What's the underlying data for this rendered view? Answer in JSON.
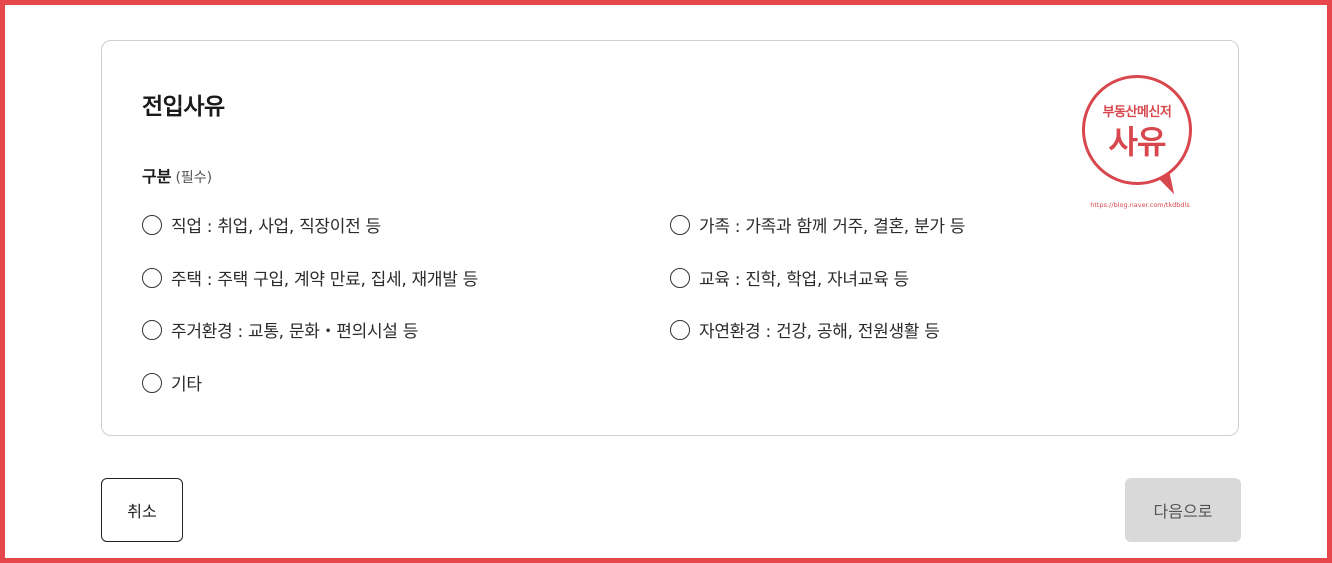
{
  "section": {
    "title": "전입사유",
    "group_label": "구분",
    "group_required": "(필수)"
  },
  "options": [
    {
      "label": "직업 : 취업, 사업, 직장이전 등",
      "selected": false
    },
    {
      "label": "가족 : 가족과 함께 거주, 결혼, 분가 등",
      "selected": false
    },
    {
      "label": "주택 : 주택 구입, 계약 만료, 집세, 재개발 등",
      "selected": false
    },
    {
      "label": "교육 : 진학, 학업, 자녀교육 등",
      "selected": false
    },
    {
      "label": "주거환경 : 교통, 문화・편의시설 등",
      "selected": false
    },
    {
      "label": "자연환경 : 건강, 공해, 전원생활 등",
      "selected": false
    },
    {
      "label": "기타",
      "selected": false
    }
  ],
  "stamp": {
    "top_text": "부동산메신저",
    "main_text": "사유",
    "url": "https://blog.naver.com/tkdbdls"
  },
  "buttons": {
    "cancel": "취소",
    "next": "다음으로"
  },
  "colors": {
    "frame_border": "#e5474b",
    "stamp_red": "#d8474d",
    "next_disabled_bg": "#d9d9d9"
  }
}
